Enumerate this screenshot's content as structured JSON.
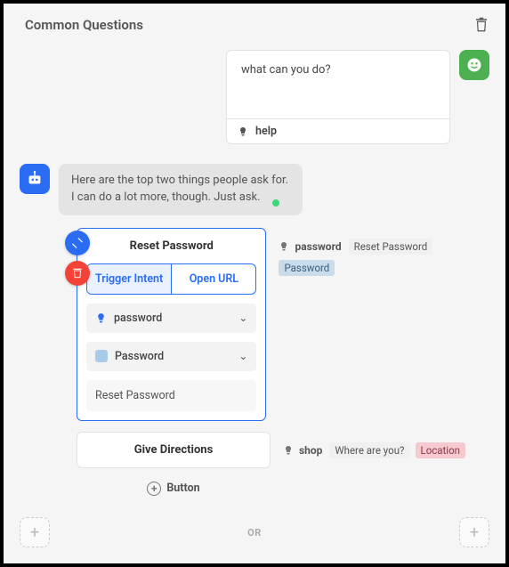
{
  "header": {
    "title": "Common Questions"
  },
  "user": {
    "message": "what can you do?",
    "intent_chip": "help"
  },
  "bot": {
    "message": "Here are the top two things people ask for. I can do a lot more, though. Just ask."
  },
  "card_selected": {
    "title": "Reset Password",
    "tabs": {
      "trigger": "Trigger Intent",
      "open_url": "Open URL"
    },
    "intent_sel": "password",
    "entity_sel": "Password",
    "text_input": "Reset Password",
    "meta": {
      "intent": "password",
      "chip1": "Reset Password",
      "chip2": "Password"
    }
  },
  "card_plain": {
    "title": "Give Directions",
    "meta": {
      "intent": "shop",
      "chip1": "Where are you?",
      "chip2": "Location"
    }
  },
  "add_button_label": "Button",
  "or_label": "OR"
}
